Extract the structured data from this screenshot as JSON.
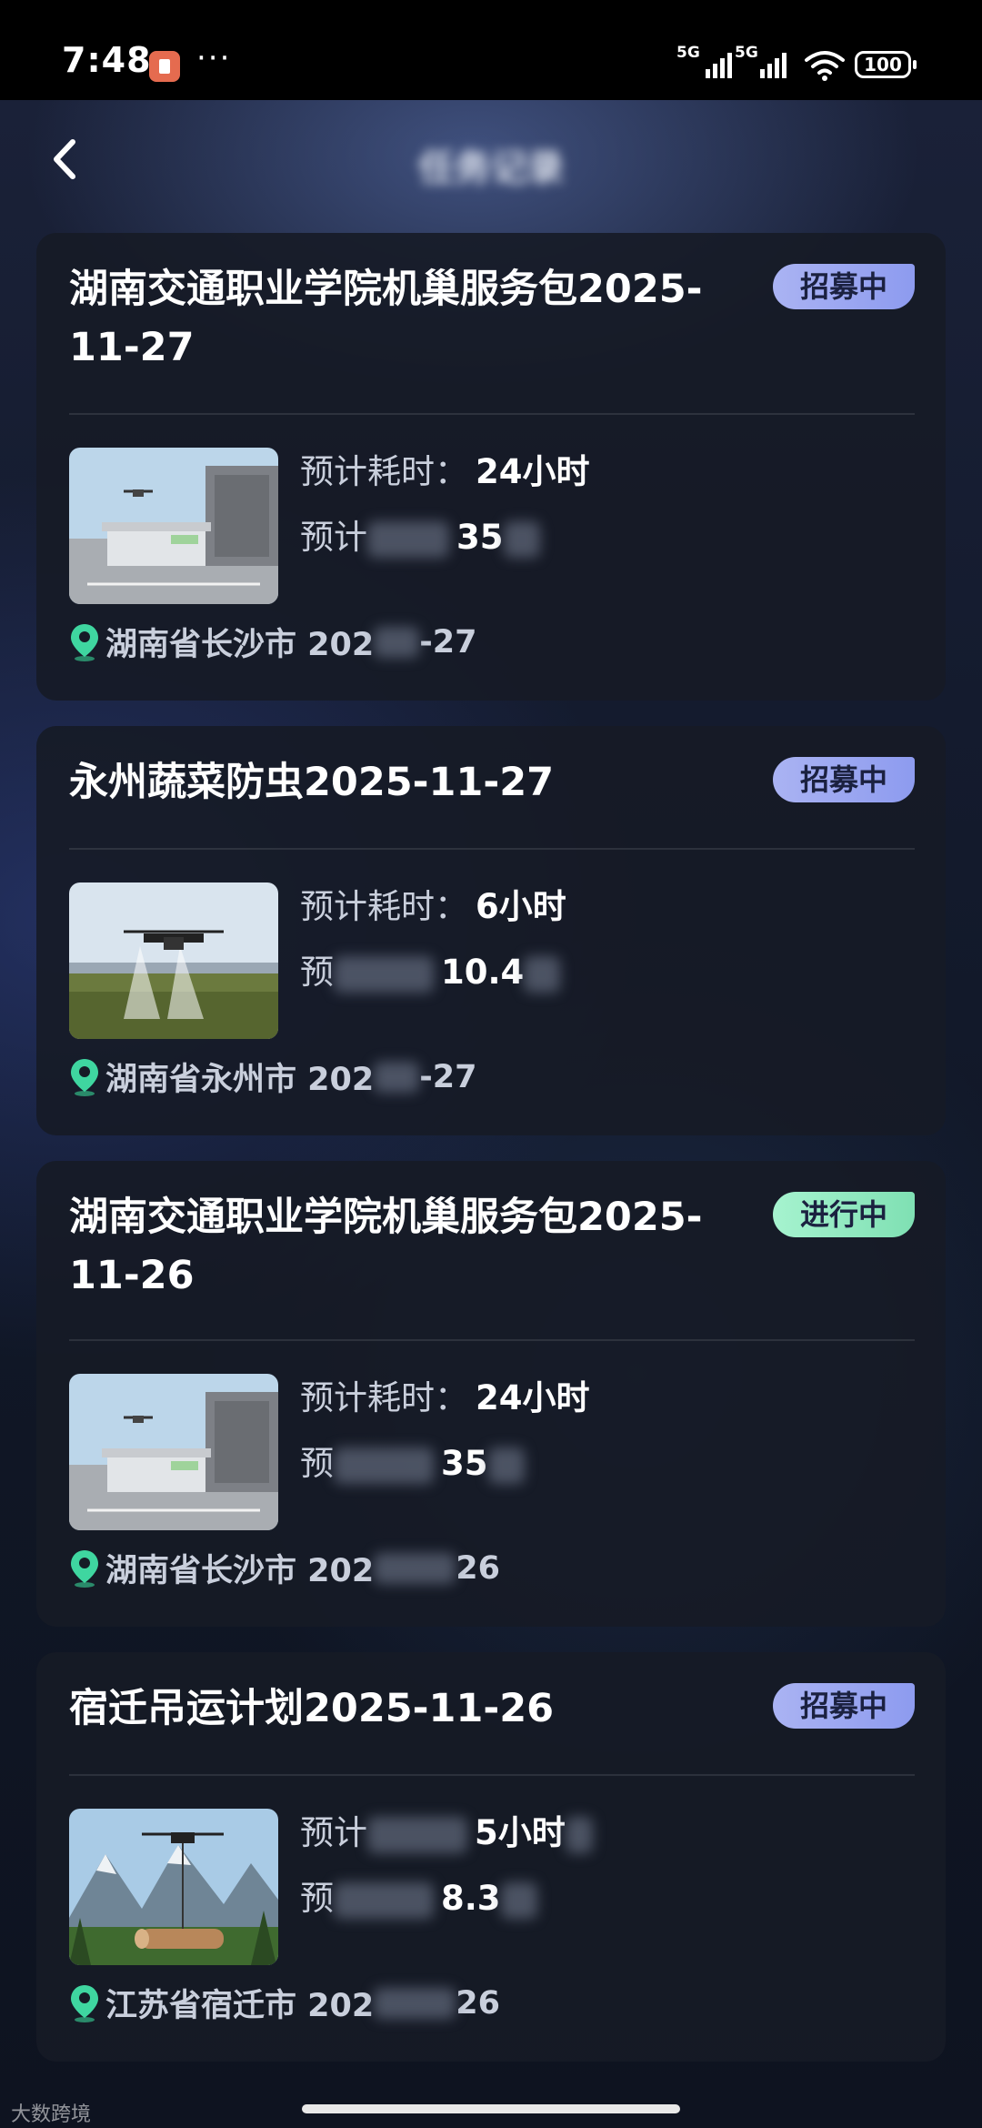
{
  "status_bar": {
    "time": "7:48",
    "more": "···",
    "net1": "5G",
    "net2": "5G",
    "battery": "100"
  },
  "header": {
    "title": "任务记录"
  },
  "cards": [
    {
      "title": "湖南交通职业学院机巢服务包2025-11-27",
      "status": "招募中",
      "status_kind": "recruit",
      "thumb": "drone-nest-image",
      "time_label": "预计耗时：",
      "time_value": "24小时",
      "income_label": "预计",
      "income_value": "35",
      "location": "湖南省长沙市 202",
      "location_tail": "-27"
    },
    {
      "title": "永州蔬菜防虫2025-11-27",
      "status": "招募中",
      "status_kind": "recruit",
      "thumb": "crop-spraying-drone-image",
      "time_label": "预计耗时：",
      "time_value": "6小时",
      "income_label": "预",
      "income_value": "10.4",
      "location": "湖南省永州市 202",
      "location_tail": "-27"
    },
    {
      "title": "湖南交通职业学院机巢服务包2025-11-26",
      "status": "进行中",
      "status_kind": "progress",
      "thumb": "drone-nest-image",
      "time_label": "预计耗时：",
      "time_value": "24小时",
      "income_label": "预",
      "income_value": "35",
      "location": "湖南省长沙市 202",
      "location_tail": "26"
    },
    {
      "title": "宿迁吊运计划2025-11-26",
      "status": "招募中",
      "status_kind": "recruit",
      "thumb": "lifting-drone-log-image",
      "time_label": "预计",
      "time_value": "5小时",
      "income_label": "预",
      "income_value": "8.3",
      "location": "江苏省宿迁市 202",
      "location_tail": "26"
    }
  ],
  "watermark": "大数跨境",
  "colors": {
    "recruit_badge": "#9aa5f1",
    "progress_badge": "#8fe9c0",
    "location_pin": "#3fd6a0"
  }
}
